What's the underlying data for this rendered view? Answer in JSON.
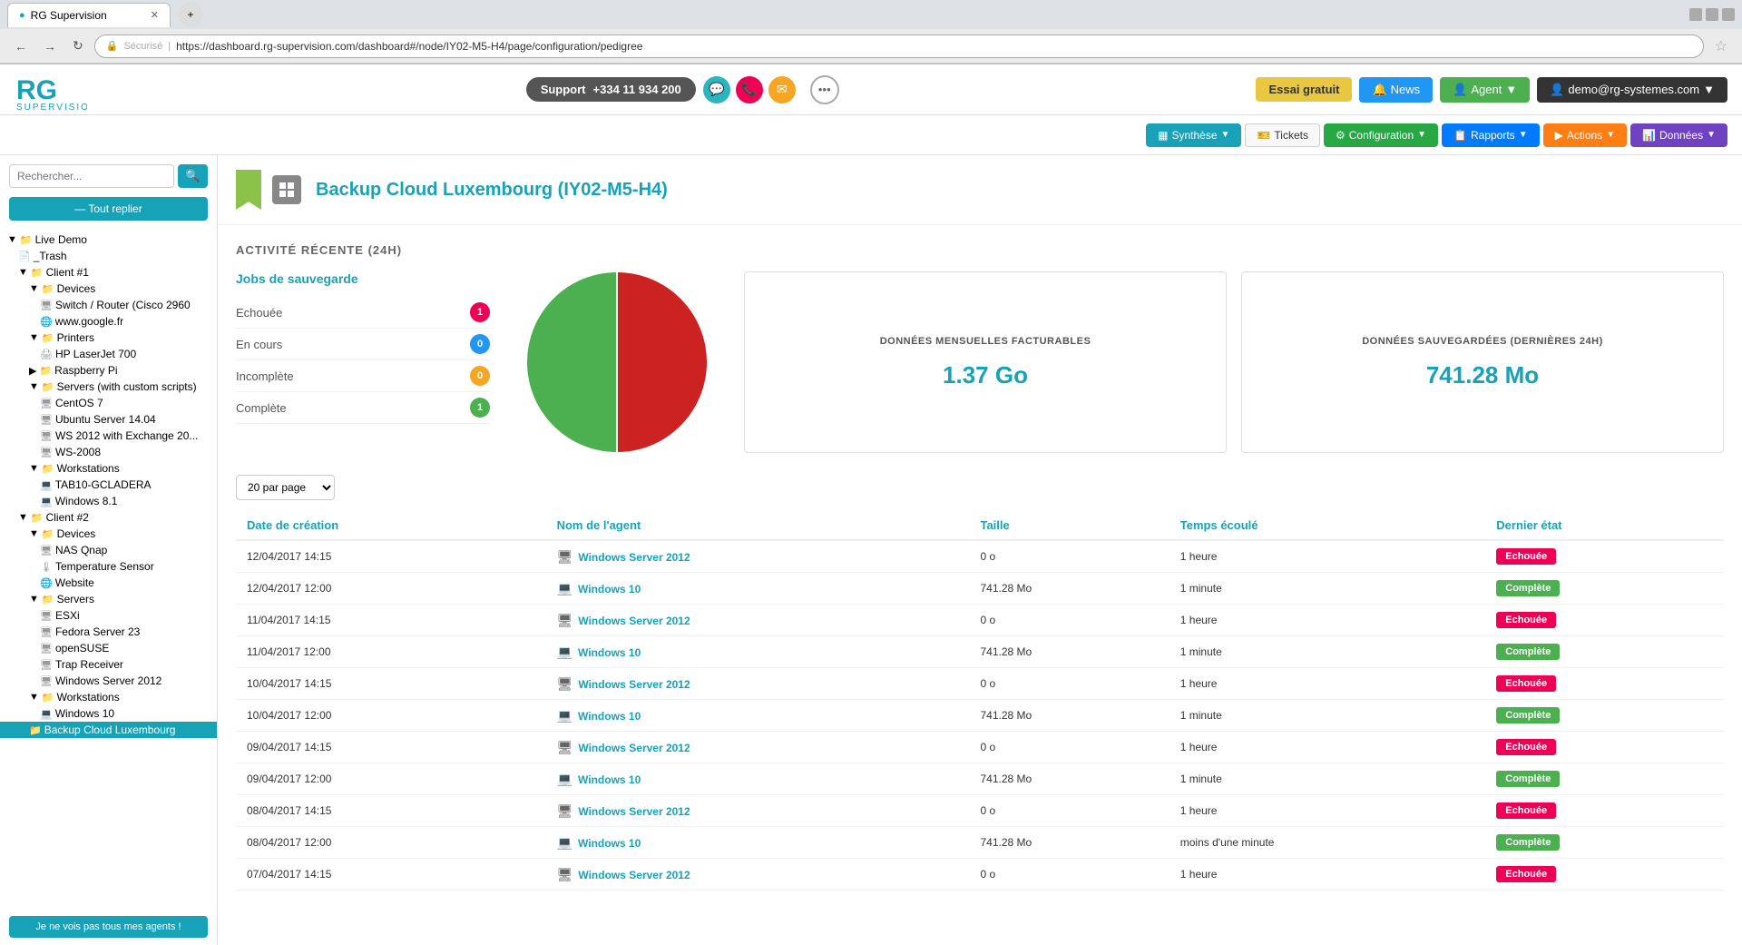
{
  "browser": {
    "tab_title": "RG Supervision",
    "url": "https://dashboard.rg-supervision.com/dashboard#/node/IY02-M5-H4/page/configuration/pedigree",
    "url_display": "https://dashboard.rg-supervision.com/dashboard#/node/IY02-M5-H4/page/configuration/pedigree"
  },
  "header": {
    "support_label": "Support",
    "phone": "+334 11 934 200",
    "essai_label": "Essai gratuit",
    "news_label": "News",
    "agent_label": "Agent",
    "user_label": "demo@rg-systemes.com"
  },
  "secondary_nav": {
    "synthese": "Synthèse",
    "tickets": "Tickets",
    "configuration": "Configuration",
    "rapports": "Rapports",
    "actions": "Actions",
    "donnees": "Données"
  },
  "sidebar": {
    "search_placeholder": "Rechercher...",
    "reply_btn": "— Tout replier",
    "tree": [
      {
        "label": "Live Demo",
        "level": 1,
        "type": "folder",
        "indent": 1
      },
      {
        "label": "_Trash",
        "level": 2,
        "type": "folder-gray",
        "indent": 2
      },
      {
        "label": "Client #1",
        "level": 2,
        "type": "folder",
        "indent": 2
      },
      {
        "label": "Devices",
        "level": 3,
        "type": "folder",
        "indent": 3
      },
      {
        "label": "Switch / Router (Cisco 2960",
        "level": 4,
        "type": "device",
        "indent": 4
      },
      {
        "label": "www.google.fr",
        "level": 4,
        "type": "device",
        "indent": 4
      },
      {
        "label": "Printers",
        "level": 3,
        "type": "folder-red",
        "indent": 3
      },
      {
        "label": "HP LaserJet 700",
        "level": 4,
        "type": "device",
        "indent": 4
      },
      {
        "label": "Raspberry Pi",
        "level": 3,
        "type": "folder-red",
        "indent": 3
      },
      {
        "label": "Servers (with custom scripts)",
        "level": 3,
        "type": "folder",
        "indent": 3
      },
      {
        "label": "CentOS 7",
        "level": 4,
        "type": "server",
        "indent": 4
      },
      {
        "label": "Ubuntu Server 14.04",
        "level": 4,
        "type": "server",
        "indent": 4
      },
      {
        "label": "WS 2012 with Exchange 20..",
        "level": 4,
        "type": "server",
        "indent": 4
      },
      {
        "label": "WS-2008",
        "level": 4,
        "type": "server",
        "indent": 4
      },
      {
        "label": "Workstations",
        "level": 3,
        "type": "folder",
        "indent": 3
      },
      {
        "label": "TAB10-GCLADERA",
        "level": 4,
        "type": "device",
        "indent": 4
      },
      {
        "label": "Windows 8.1",
        "level": 4,
        "type": "device",
        "indent": 4
      },
      {
        "label": "Client #2",
        "level": 2,
        "type": "folder",
        "indent": 2
      },
      {
        "label": "Devices",
        "level": 3,
        "type": "folder",
        "indent": 3
      },
      {
        "label": "NAS Qnap",
        "level": 4,
        "type": "device",
        "indent": 4
      },
      {
        "label": "Temperature Sensor",
        "level": 4,
        "type": "device",
        "indent": 4
      },
      {
        "label": "Website",
        "level": 4,
        "type": "device",
        "indent": 4
      },
      {
        "label": "Servers",
        "level": 3,
        "type": "folder",
        "indent": 3
      },
      {
        "label": "ESXi",
        "level": 4,
        "type": "server",
        "indent": 4
      },
      {
        "label": "Fedora Server 23",
        "level": 4,
        "type": "server",
        "indent": 4
      },
      {
        "label": "openSUSE",
        "level": 4,
        "type": "server",
        "indent": 4
      },
      {
        "label": "Trap Receiver",
        "level": 4,
        "type": "server",
        "indent": 4
      },
      {
        "label": "Windows Server 2012",
        "level": 4,
        "type": "server",
        "indent": 4
      },
      {
        "label": "Workstations",
        "level": 3,
        "type": "folder",
        "indent": 3
      },
      {
        "label": "Windows 10",
        "level": 4,
        "type": "device",
        "indent": 4
      },
      {
        "label": "Backup Cloud Luxembourg",
        "level": 3,
        "type": "folder",
        "indent": 3,
        "selected": true
      }
    ],
    "agent_warning": "Je ne vois pas tous mes agents !"
  },
  "page": {
    "title": "Backup Cloud Luxembourg (IY02-M5-H4)",
    "activity_title": "ACTIVITÉ RÉCENTE (24H)",
    "jobs_section_title": "Jobs de sauvegarde",
    "jobs": [
      {
        "label": "Echouée",
        "count": "1",
        "badge": "red"
      },
      {
        "label": "En cours",
        "count": "0",
        "badge": "blue"
      },
      {
        "label": "Incomplète",
        "count": "0",
        "badge": "orange"
      },
      {
        "label": "Complète",
        "count": "1",
        "badge": "green"
      }
    ],
    "pie": {
      "failed_pct": 50,
      "complete_pct": 50,
      "failed_color": "#cc2222",
      "complete_color": "#4caf50"
    },
    "stats": [
      {
        "title": "DONNÉES MENSUELLES FACTURABLES",
        "value": "1.37 Go"
      },
      {
        "title": "DONNÉES SAUVEGARDÉES (DERNIÈRES 24H)",
        "value": "741.28 Mo"
      }
    ],
    "per_page_label": "20 par page",
    "table_headers": [
      "Date de création",
      "Nom de l'agent",
      "Taille",
      "Temps écoulé",
      "Dernier état"
    ],
    "table_rows": [
      {
        "date": "12/04/2017 14:15",
        "agent": "Windows Server 2012",
        "type": "server",
        "size": "0 o",
        "time": "1 heure",
        "status": "Echouée",
        "status_type": "failed"
      },
      {
        "date": "12/04/2017 12:00",
        "agent": "Windows 10",
        "type": "workstation",
        "size": "741.28 Mo",
        "time": "1 minute",
        "status": "Complète",
        "status_type": "complete"
      },
      {
        "date": "11/04/2017 14:15",
        "agent": "Windows Server 2012",
        "type": "server",
        "size": "0 o",
        "time": "1 heure",
        "status": "Echouée",
        "status_type": "failed"
      },
      {
        "date": "11/04/2017 12:00",
        "agent": "Windows 10",
        "type": "workstation",
        "size": "741.28 Mo",
        "time": "1 minute",
        "status": "Complète",
        "status_type": "complete"
      },
      {
        "date": "10/04/2017 14:15",
        "agent": "Windows Server 2012",
        "type": "server",
        "size": "0 o",
        "time": "1 heure",
        "status": "Echouée",
        "status_type": "failed"
      },
      {
        "date": "10/04/2017 12:00",
        "agent": "Windows 10",
        "type": "workstation",
        "size": "741.28 Mo",
        "time": "1 minute",
        "status": "Complète",
        "status_type": "complete"
      },
      {
        "date": "09/04/2017 14:15",
        "agent": "Windows Server 2012",
        "type": "server",
        "size": "0 o",
        "time": "1 heure",
        "status": "Echouée",
        "status_type": "failed"
      },
      {
        "date": "09/04/2017 12:00",
        "agent": "Windows 10",
        "type": "workstation",
        "size": "741.28 Mo",
        "time": "1 minute",
        "status": "Complète",
        "status_type": "complete"
      },
      {
        "date": "08/04/2017 14:15",
        "agent": "Windows Server 2012",
        "type": "server",
        "size": "0 o",
        "time": "1 heure",
        "status": "Echouée",
        "status_type": "failed"
      },
      {
        "date": "08/04/2017 12:00",
        "agent": "Windows 10",
        "type": "workstation",
        "size": "741.28 Mo",
        "time": "moins d'une minute",
        "status": "Complète",
        "status_type": "complete"
      },
      {
        "date": "07/04/2017 14:15",
        "agent": "Windows Server 2012",
        "type": "server",
        "size": "0 o",
        "time": "1 heure",
        "status": "Echouée",
        "status_type": "failed"
      }
    ]
  }
}
